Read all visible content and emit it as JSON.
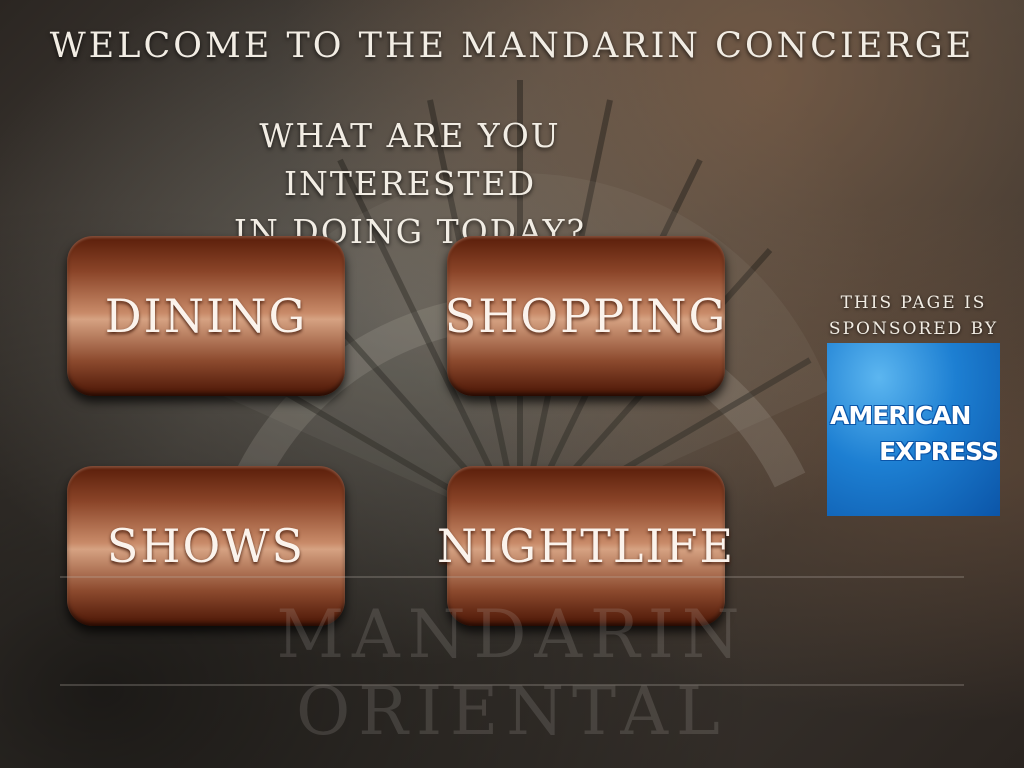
{
  "header": {
    "title": "Welcome to the Mandarin Concierge",
    "question_line1": "What are you interested",
    "question_line2": "in doing today?"
  },
  "buttons": [
    {
      "label": "Dining"
    },
    {
      "label": "Shopping"
    },
    {
      "label": "Shows"
    },
    {
      "label": "Nightlife"
    }
  ],
  "sponsor": {
    "line1": "This page is",
    "line2": "sponsored by",
    "logo_line1": "AMERICAN",
    "logo_line2": "EXPRESS",
    "logo_color": "#1d7fd2"
  },
  "watermark": {
    "text": "MANDARIN ORIENTAL"
  },
  "colors": {
    "button_dark": "#5a1e0a",
    "button_light": "#d6a282",
    "text": "#f2ede4"
  }
}
